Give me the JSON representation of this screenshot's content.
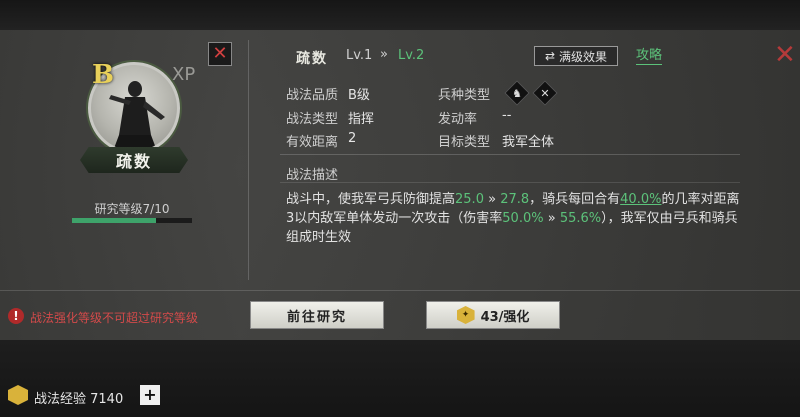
{
  "hero": {
    "grade": "B",
    "xp_label": "XP",
    "close_glyph": "✕",
    "name": "疏数",
    "research_level_label": "研究等级7/10",
    "research_progress": 0.7
  },
  "skill": {
    "name": "疏数",
    "level_current": "Lv.1",
    "level_arrow": "»",
    "level_next": "Lv.2",
    "full_effect_label": "满级效果",
    "full_effect_icon": "⇄",
    "guide_label": "攻略"
  },
  "attributes": {
    "quality_label": "战法品质",
    "quality_value": "B级",
    "type_label": "战法类型",
    "type_value": "指挥",
    "distance_label": "有效距离",
    "distance_value": "2",
    "troop_label": "兵种类型",
    "troop_icons": [
      "horse-icon",
      "crossbow-icon"
    ],
    "rate_label": "发动率",
    "rate_value": "--",
    "target_label": "目标类型",
    "target_value": "我军全体"
  },
  "description": {
    "title": "战法描述",
    "part1": "战斗中，使我军弓兵防御提高",
    "v1": "25.0",
    "arrow1": " » ",
    "v2": "27.8",
    "part2": "，骑兵每回合有",
    "v3": "40.0%",
    "part3": "的几率对距离3以内敌军单体发动一次攻击（伤害率",
    "v4": "50.0%",
    "arrow2": " » ",
    "v5": "55.6%",
    "part4": "），我军仅由弓兵和骑兵组成时生效"
  },
  "footer": {
    "warning": "战法强化等级不可超过研究等级",
    "research_button": "前往研究",
    "upgrade_button": "43/强化",
    "exp_label": "战法经验 7140",
    "plus": "+"
  },
  "colors": {
    "accent_green": "#5cc27a",
    "warning_red": "#d24a4a",
    "grade_gold": "#e8d05a"
  }
}
